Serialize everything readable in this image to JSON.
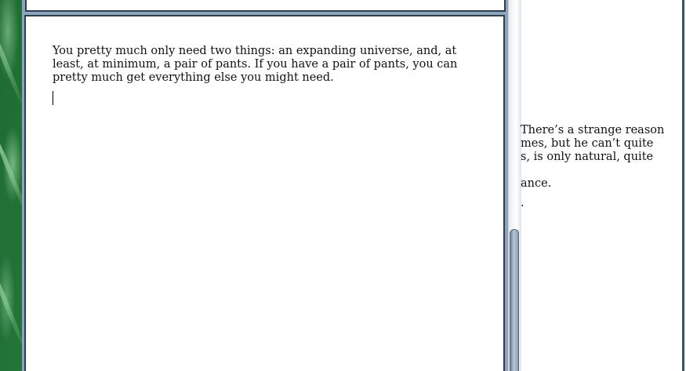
{
  "main_document": {
    "paragraph": "You pretty much only need two things: an expanding universe, and, at least, at minimum, a pair of pants. If you have a pair of pants, you can pretty much get everything else you might need."
  },
  "background_document": {
    "lines": [
      "There’s a strange reason",
      "mes, but he can’t quite",
      "s, is only natural, quite",
      "ance.",
      "."
    ]
  }
}
